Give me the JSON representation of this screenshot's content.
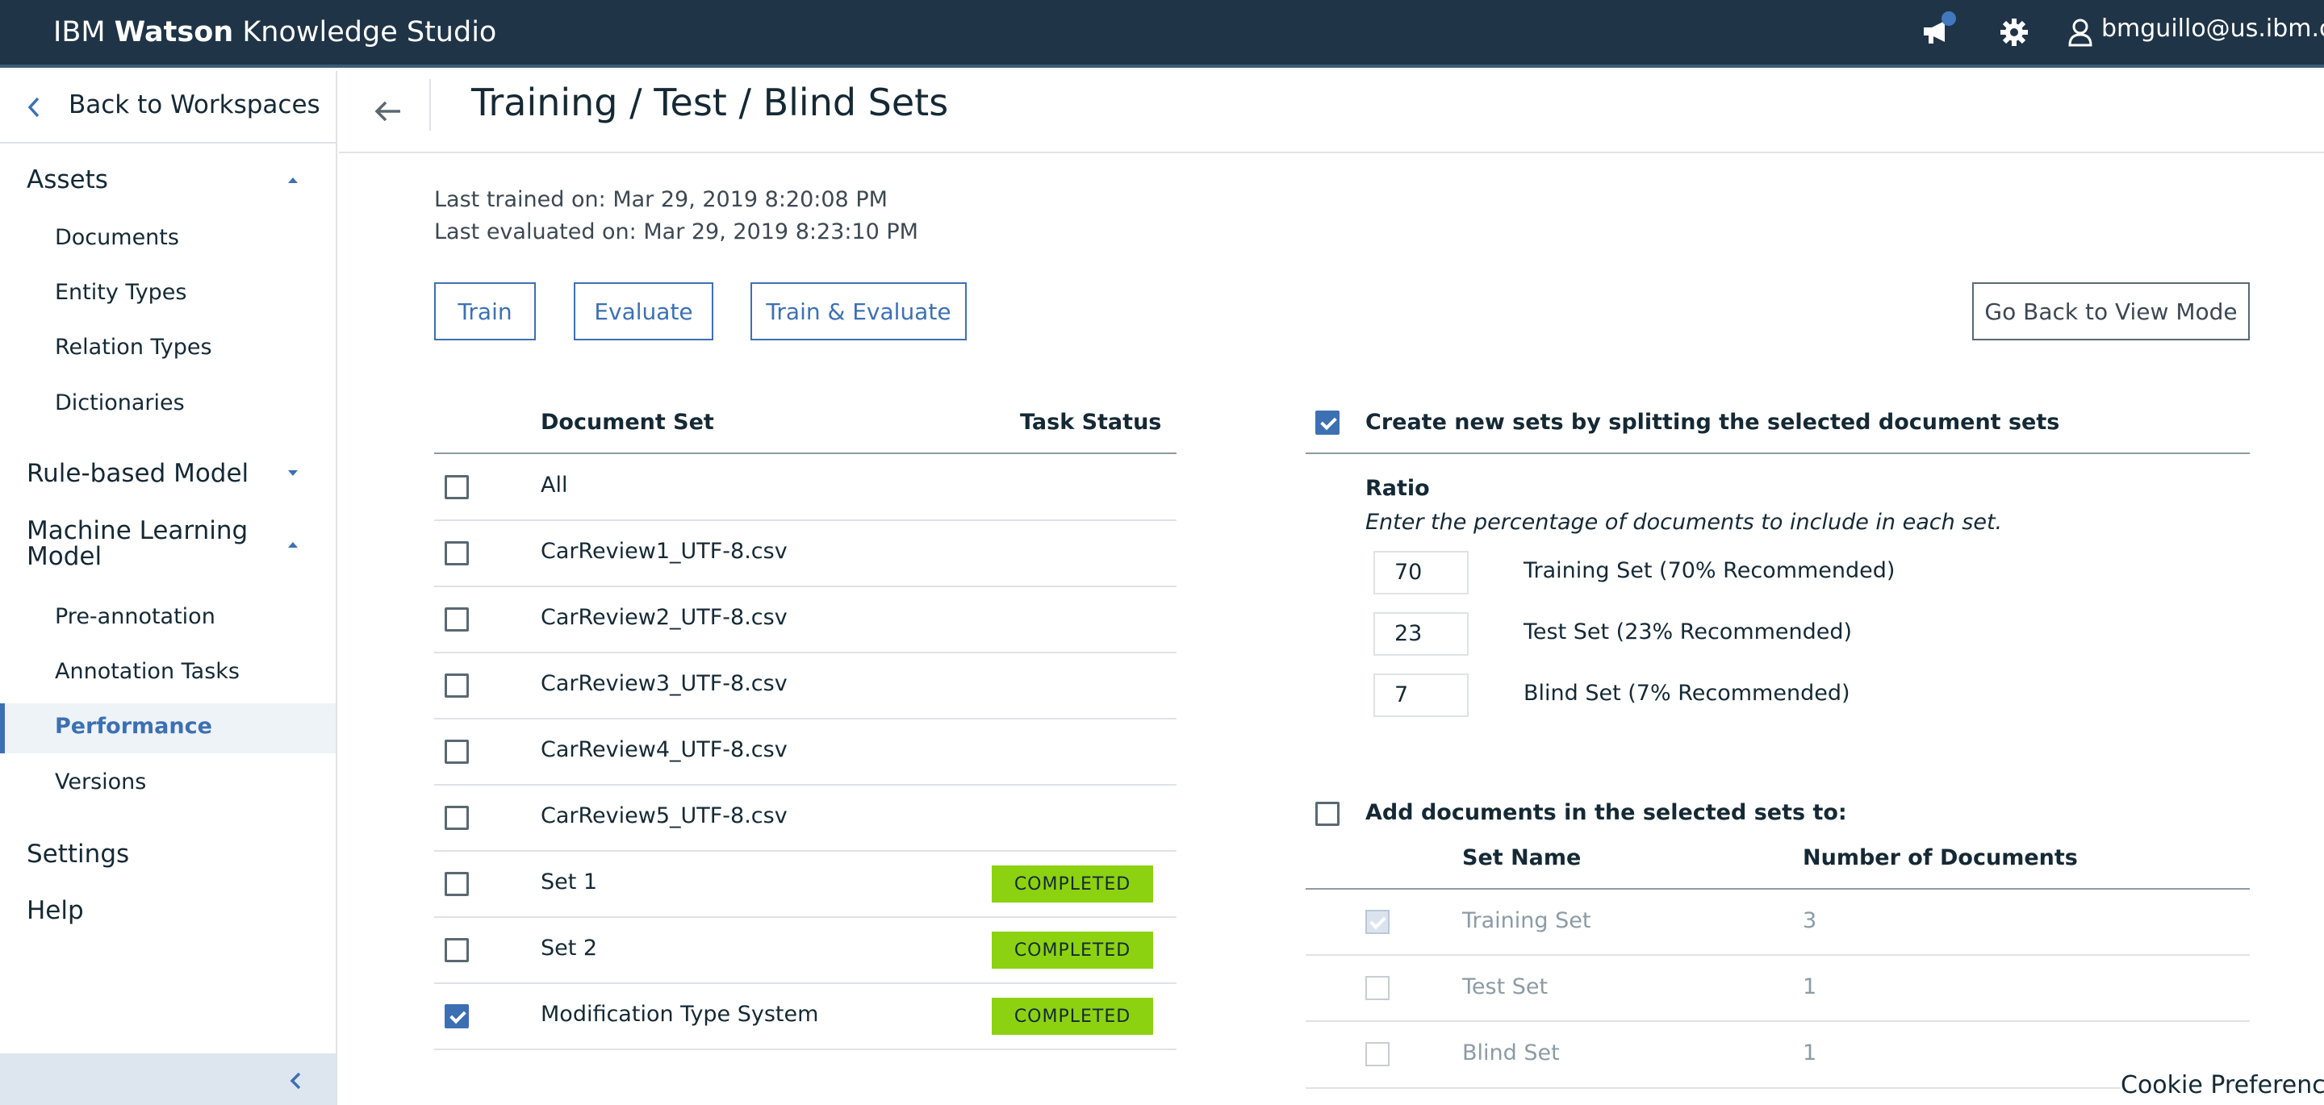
{
  "header": {
    "brand_prefix": "IBM",
    "brand_bold": "Watson",
    "brand_suffix": "Knowledge Studio",
    "user_email": "bmguillo@us.ibm.com",
    "icons": [
      "megaphone-icon",
      "gear-icon",
      "user-icon"
    ]
  },
  "sidebar": {
    "back_label": "Back to Workspaces",
    "assets": "Assets",
    "documents": "Documents",
    "entity_types": "Entity Types",
    "relation_types": "Relation Types",
    "dictionaries": "Dictionaries",
    "rule_based": "Rule-based Model",
    "ml_model_line1": "Machine Learning",
    "ml_model_line2": "Model",
    "pre_annotation": "Pre-annotation",
    "annotation_tasks": "Annotation Tasks",
    "performance": "Performance",
    "versions": "Versions",
    "settings": "Settings",
    "help": "Help"
  },
  "main": {
    "title": "Training / Test / Blind Sets",
    "last_trained": "Last trained on: Mar 29, 2019 8:20:08 PM",
    "last_evaluated": "Last evaluated on: Mar 29, 2019 8:23:10 PM",
    "buttons": {
      "train": "Train",
      "evaluate": "Evaluate",
      "train_evaluate": "Train & Evaluate",
      "view_mode": "Go Back to View Mode"
    }
  },
  "doc_table": {
    "col_set": "Document Set",
    "col_status": "Task Status",
    "rows": [
      {
        "name": "All",
        "status": "",
        "checked": false
      },
      {
        "name": "CarReview1_UTF-8.csv",
        "status": "",
        "checked": false
      },
      {
        "name": "CarReview2_UTF-8.csv",
        "status": "",
        "checked": false
      },
      {
        "name": "CarReview3_UTF-8.csv",
        "status": "",
        "checked": false
      },
      {
        "name": "CarReview4_UTF-8.csv",
        "status": "",
        "checked": false
      },
      {
        "name": "CarReview5_UTF-8.csv",
        "status": "",
        "checked": false
      },
      {
        "name": "Set 1",
        "status": "COMPLETED",
        "checked": false
      },
      {
        "name": "Set 2",
        "status": "COMPLETED",
        "checked": false
      },
      {
        "name": "Modification Type System",
        "status": "COMPLETED",
        "checked": true
      }
    ]
  },
  "split": {
    "checked": true,
    "title": "Create new sets by splitting the selected document sets",
    "ratio_label": "Ratio",
    "ratio_desc": "Enter the percentage of documents to include in each set.",
    "training_value": "70",
    "training_label": "Training Set  (70% Recommended)",
    "test_value": "23",
    "test_label": "Test Set  (23% Recommended)",
    "blind_value": "7",
    "blind_label": "Blind Set  (7% Recommended)"
  },
  "add_docs": {
    "checked": false,
    "title": "Add documents in the selected sets to:",
    "col_name": "Set Name",
    "col_count": "Number of Documents",
    "rows": [
      {
        "name": "Training Set",
        "count": "3",
        "checked": true
      },
      {
        "name": "Test Set",
        "count": "1",
        "checked": false
      },
      {
        "name": "Blind Set",
        "count": "1",
        "checked": false
      }
    ]
  },
  "cookie": "Cookie Preferences",
  "colors": {
    "topbar": "#1f3446",
    "accent": "#3d70b2",
    "completed": "#8cd211"
  }
}
